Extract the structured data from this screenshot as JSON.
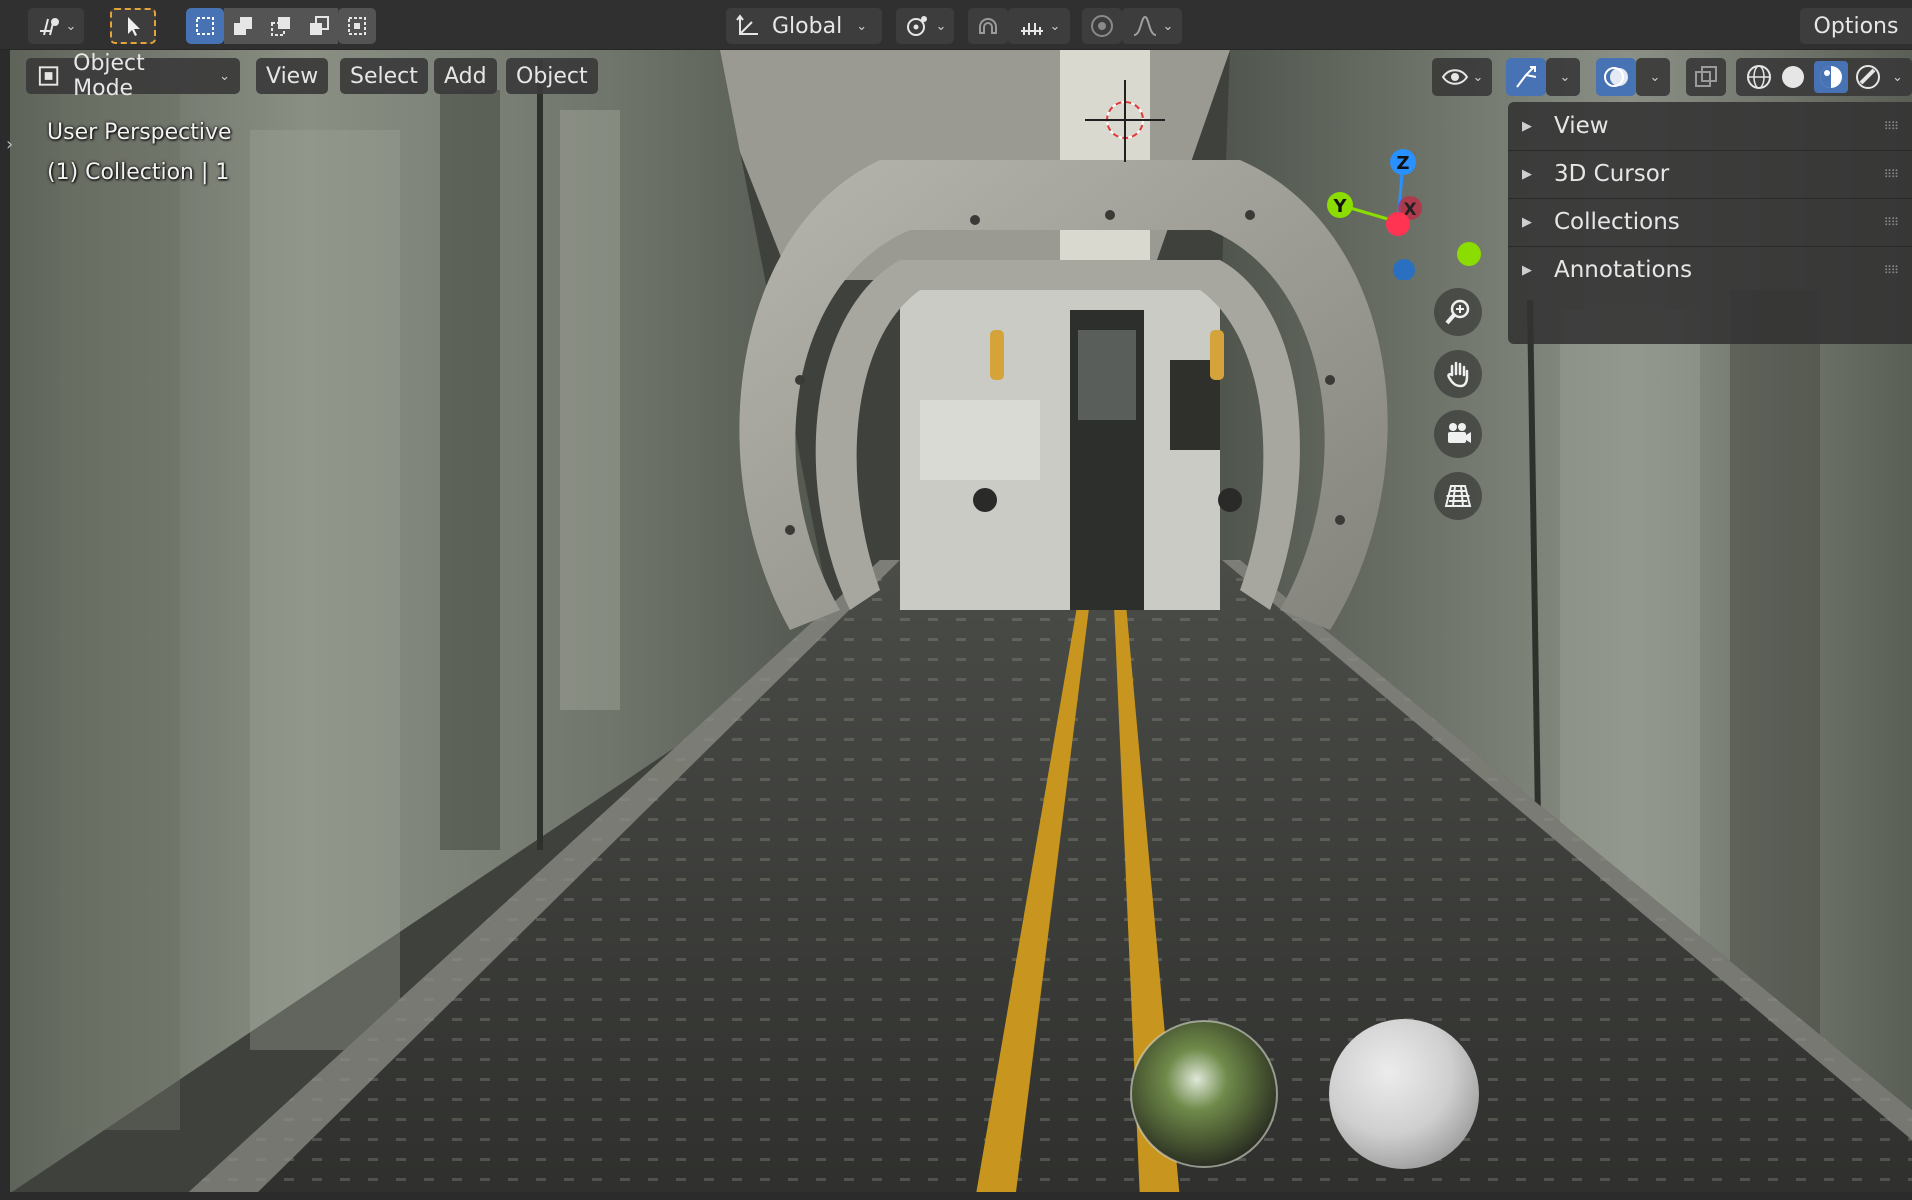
{
  "header": {
    "editor_type_icon": "3d-viewport-editor-icon",
    "tools": [
      "select-cursor-icon"
    ],
    "selection_modes": [
      "select-new-icon",
      "select-extend-icon",
      "select-subtract-icon",
      "select-invert-icon",
      "select-intersect-icon"
    ],
    "transform_orientation": "Global",
    "options_label": "Options"
  },
  "viewport_header": {
    "mode": "Object Mode",
    "menus": {
      "view": "View",
      "select": "Select",
      "add": "Add",
      "object": "Object"
    }
  },
  "overlay": {
    "perspective": "User Perspective",
    "collection": "(1) Collection | 1"
  },
  "gizmo": {
    "z": "Z",
    "y": "Y",
    "x": "X"
  },
  "sidebar": {
    "items": [
      {
        "label": "View"
      },
      {
        "label": "3D Cursor"
      },
      {
        "label": "Collections"
      },
      {
        "label": "Annotations"
      }
    ]
  },
  "nav_buttons": [
    "zoom-icon",
    "hand-pan-icon",
    "camera-icon",
    "grid-ortho-icon"
  ],
  "colors": {
    "header_bg": "#303030",
    "button_bg": "#545454",
    "active_blue": "#4772b3",
    "axis_x": "#ff3352",
    "axis_y": "#8bdc00",
    "axis_z": "#2890ff",
    "floor_stripe": "#c8961e"
  }
}
